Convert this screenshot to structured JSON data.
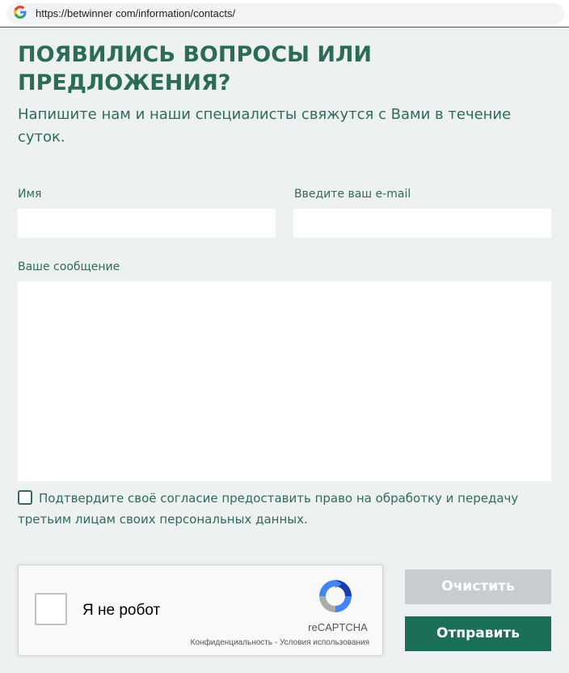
{
  "browser": {
    "url": "https://betwinner com/information/contacts/",
    "favicon": "google-g-icon"
  },
  "contact_form": {
    "title": "ПОЯВИЛИСЬ ВОПРОСЫ ИЛИ ПРЕДЛОЖЕНИЯ?",
    "subtitle": "Напишите нам и наши специалисты свяжутся с Вами в течение суток.",
    "name_field": {
      "label": "Имя",
      "value": ""
    },
    "email_field": {
      "label": "Введите ваш e-mail",
      "value": ""
    },
    "message_field": {
      "label": "Ваше сообщение",
      "value": ""
    },
    "consent": {
      "checked": false,
      "text": "Подтвердите своё согласие предоставить право на обработку и передачу третьим лицам своих персональных данных."
    },
    "recaptcha": {
      "label": "Я не робот",
      "brand": "reCAPTCHA",
      "privacy_link": "Конфиденциальность",
      "separator": "-",
      "terms_link": "Условия использования",
      "icon": "recaptcha-logo-icon"
    },
    "buttons": {
      "clear_label": "Очистить",
      "send_label": "Отправить"
    }
  },
  "colors": {
    "accent": "#1b6e57",
    "text": "#2f6b5b",
    "page_bg": "#eef1f1",
    "disabled_button": "#c9ccce"
  }
}
